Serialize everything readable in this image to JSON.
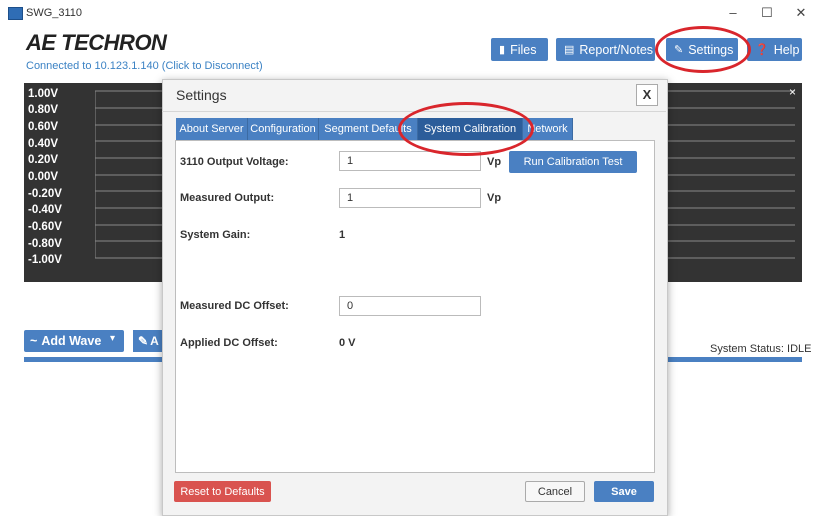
{
  "window": {
    "title": "SWG_3110",
    "minimize_glyph": "–",
    "maximize_glyph": "☐",
    "close_glyph": "✕"
  },
  "header": {
    "logo": "AE TECHRON",
    "connection": "Connected to 10.123.1.140 (Click to Disconnect)",
    "buttons": {
      "files": "Files",
      "report": "Report/Notes",
      "settings": "Settings",
      "help": "Help"
    },
    "icons": {
      "files": "folder-icon",
      "report": "clipboard-icon",
      "settings": "wrench-icon",
      "help": "question-icon"
    }
  },
  "chart": {
    "y_ticks": [
      "1.00V",
      "0.80V",
      "0.60V",
      "0.40V",
      "0.20V",
      "0.00V",
      "-0.20V",
      "-0.40V",
      "-0.60V",
      "-0.80V",
      "-1.00V"
    ],
    "close_glyph": "×",
    "background": "#333333"
  },
  "toolbar": {
    "add_wave": "Add Wave",
    "add_wave_icon": "~",
    "second_button": "A",
    "system_status": "System Status: IDLE"
  },
  "dialog": {
    "title": "Settings",
    "close_glyph": "X",
    "tabs": [
      {
        "label": "About Server"
      },
      {
        "label": "Configuration"
      },
      {
        "label": "Segment Defaults"
      },
      {
        "label": "System Calibration",
        "active": true
      },
      {
        "label": "Network"
      }
    ],
    "fields": {
      "output_voltage_label": "3110 Output Voltage:",
      "output_voltage_value": "1",
      "output_voltage_unit": "Vp",
      "run_calibration": "Run Calibration Test",
      "measured_output_label": "Measured Output:",
      "measured_output_value": "1",
      "measured_output_unit": "Vp",
      "system_gain_label": "System Gain:",
      "system_gain_value": "1",
      "measured_dc_label": "Measured DC Offset:",
      "measured_dc_value": "0",
      "applied_dc_label": "Applied DC Offset:",
      "applied_dc_value": "0 V"
    },
    "buttons": {
      "reset": "Reset to Defaults",
      "cancel": "Cancel",
      "save": "Save"
    }
  },
  "colors": {
    "accent": "#4a80c2",
    "active_tab": "#2c5d9a",
    "danger": "#d9534f",
    "annotation": "#d9262c"
  }
}
